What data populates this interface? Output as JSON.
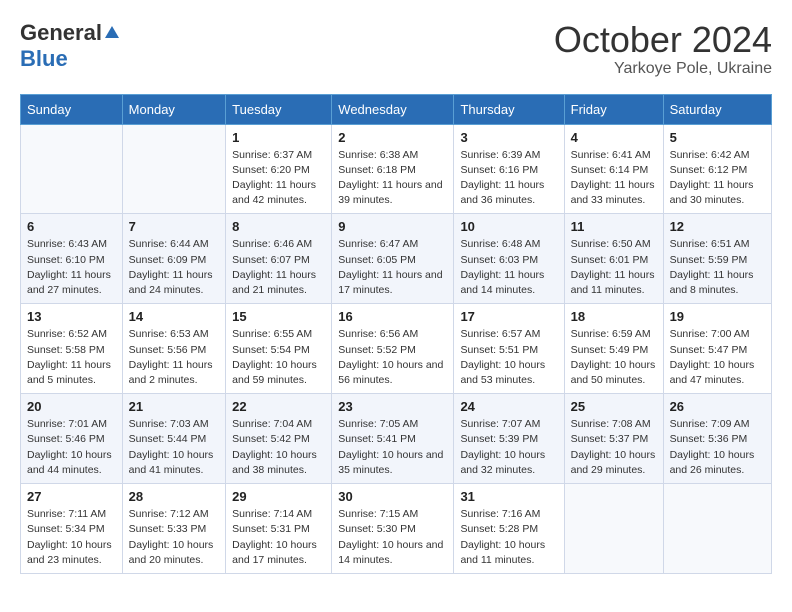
{
  "header": {
    "logo_general": "General",
    "logo_blue": "Blue",
    "month": "October 2024",
    "location": "Yarkoye Pole, Ukraine"
  },
  "weekdays": [
    "Sunday",
    "Monday",
    "Tuesday",
    "Wednesday",
    "Thursday",
    "Friday",
    "Saturday"
  ],
  "weeks": [
    [
      {
        "day": "",
        "info": ""
      },
      {
        "day": "",
        "info": ""
      },
      {
        "day": "1",
        "info": "Sunrise: 6:37 AM\nSunset: 6:20 PM\nDaylight: 11 hours and 42 minutes."
      },
      {
        "day": "2",
        "info": "Sunrise: 6:38 AM\nSunset: 6:18 PM\nDaylight: 11 hours and 39 minutes."
      },
      {
        "day": "3",
        "info": "Sunrise: 6:39 AM\nSunset: 6:16 PM\nDaylight: 11 hours and 36 minutes."
      },
      {
        "day": "4",
        "info": "Sunrise: 6:41 AM\nSunset: 6:14 PM\nDaylight: 11 hours and 33 minutes."
      },
      {
        "day": "5",
        "info": "Sunrise: 6:42 AM\nSunset: 6:12 PM\nDaylight: 11 hours and 30 minutes."
      }
    ],
    [
      {
        "day": "6",
        "info": "Sunrise: 6:43 AM\nSunset: 6:10 PM\nDaylight: 11 hours and 27 minutes."
      },
      {
        "day": "7",
        "info": "Sunrise: 6:44 AM\nSunset: 6:09 PM\nDaylight: 11 hours and 24 minutes."
      },
      {
        "day": "8",
        "info": "Sunrise: 6:46 AM\nSunset: 6:07 PM\nDaylight: 11 hours and 21 minutes."
      },
      {
        "day": "9",
        "info": "Sunrise: 6:47 AM\nSunset: 6:05 PM\nDaylight: 11 hours and 17 minutes."
      },
      {
        "day": "10",
        "info": "Sunrise: 6:48 AM\nSunset: 6:03 PM\nDaylight: 11 hours and 14 minutes."
      },
      {
        "day": "11",
        "info": "Sunrise: 6:50 AM\nSunset: 6:01 PM\nDaylight: 11 hours and 11 minutes."
      },
      {
        "day": "12",
        "info": "Sunrise: 6:51 AM\nSunset: 5:59 PM\nDaylight: 11 hours and 8 minutes."
      }
    ],
    [
      {
        "day": "13",
        "info": "Sunrise: 6:52 AM\nSunset: 5:58 PM\nDaylight: 11 hours and 5 minutes."
      },
      {
        "day": "14",
        "info": "Sunrise: 6:53 AM\nSunset: 5:56 PM\nDaylight: 11 hours and 2 minutes."
      },
      {
        "day": "15",
        "info": "Sunrise: 6:55 AM\nSunset: 5:54 PM\nDaylight: 10 hours and 59 minutes."
      },
      {
        "day": "16",
        "info": "Sunrise: 6:56 AM\nSunset: 5:52 PM\nDaylight: 10 hours and 56 minutes."
      },
      {
        "day": "17",
        "info": "Sunrise: 6:57 AM\nSunset: 5:51 PM\nDaylight: 10 hours and 53 minutes."
      },
      {
        "day": "18",
        "info": "Sunrise: 6:59 AM\nSunset: 5:49 PM\nDaylight: 10 hours and 50 minutes."
      },
      {
        "day": "19",
        "info": "Sunrise: 7:00 AM\nSunset: 5:47 PM\nDaylight: 10 hours and 47 minutes."
      }
    ],
    [
      {
        "day": "20",
        "info": "Sunrise: 7:01 AM\nSunset: 5:46 PM\nDaylight: 10 hours and 44 minutes."
      },
      {
        "day": "21",
        "info": "Sunrise: 7:03 AM\nSunset: 5:44 PM\nDaylight: 10 hours and 41 minutes."
      },
      {
        "day": "22",
        "info": "Sunrise: 7:04 AM\nSunset: 5:42 PM\nDaylight: 10 hours and 38 minutes."
      },
      {
        "day": "23",
        "info": "Sunrise: 7:05 AM\nSunset: 5:41 PM\nDaylight: 10 hours and 35 minutes."
      },
      {
        "day": "24",
        "info": "Sunrise: 7:07 AM\nSunset: 5:39 PM\nDaylight: 10 hours and 32 minutes."
      },
      {
        "day": "25",
        "info": "Sunrise: 7:08 AM\nSunset: 5:37 PM\nDaylight: 10 hours and 29 minutes."
      },
      {
        "day": "26",
        "info": "Sunrise: 7:09 AM\nSunset: 5:36 PM\nDaylight: 10 hours and 26 minutes."
      }
    ],
    [
      {
        "day": "27",
        "info": "Sunrise: 7:11 AM\nSunset: 5:34 PM\nDaylight: 10 hours and 23 minutes."
      },
      {
        "day": "28",
        "info": "Sunrise: 7:12 AM\nSunset: 5:33 PM\nDaylight: 10 hours and 20 minutes."
      },
      {
        "day": "29",
        "info": "Sunrise: 7:14 AM\nSunset: 5:31 PM\nDaylight: 10 hours and 17 minutes."
      },
      {
        "day": "30",
        "info": "Sunrise: 7:15 AM\nSunset: 5:30 PM\nDaylight: 10 hours and 14 minutes."
      },
      {
        "day": "31",
        "info": "Sunrise: 7:16 AM\nSunset: 5:28 PM\nDaylight: 10 hours and 11 minutes."
      },
      {
        "day": "",
        "info": ""
      },
      {
        "day": "",
        "info": ""
      }
    ]
  ]
}
